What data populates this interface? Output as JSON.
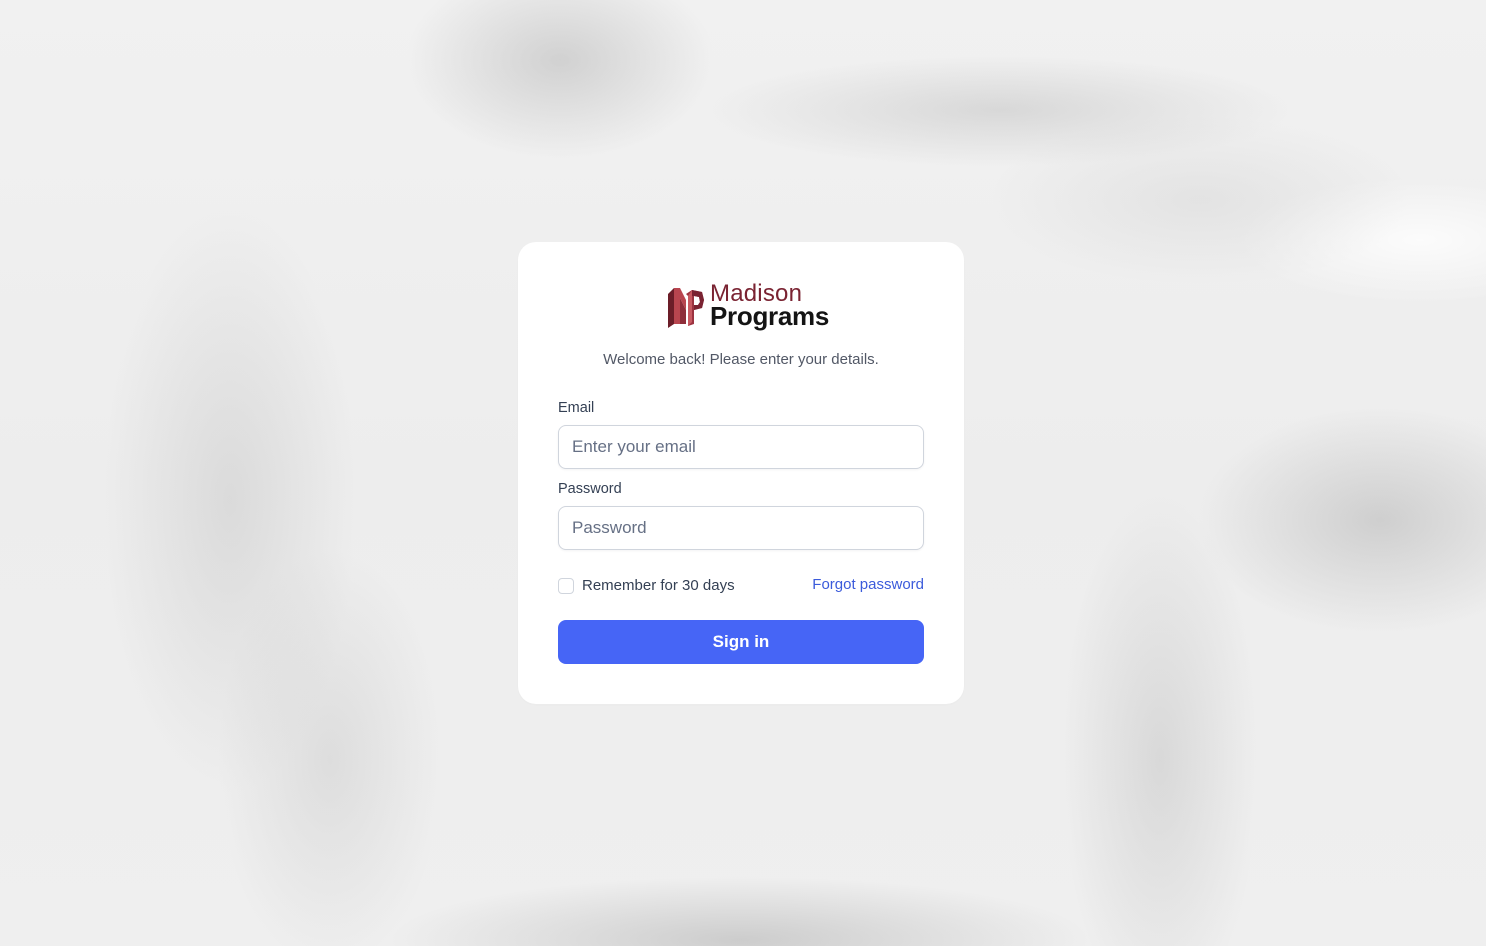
{
  "brand": {
    "name_line1": "Madison",
    "name_line2": "Programs",
    "primary_color": "#7a2332",
    "logo_icon": "madison-programs-logo-icon"
  },
  "login": {
    "welcome_text": "Welcome back! Please enter your details.",
    "email_label": "Email",
    "email_placeholder": "Enter your email",
    "email_value": "",
    "password_label": "Password",
    "password_placeholder": "Password",
    "password_value": "",
    "remember_label": "Remember for 30 days",
    "remember_checked": false,
    "forgot_label": "Forgot password",
    "signin_label": "Sign in",
    "accent_color": "#4665f6",
    "link_color": "#3b5bdb"
  }
}
